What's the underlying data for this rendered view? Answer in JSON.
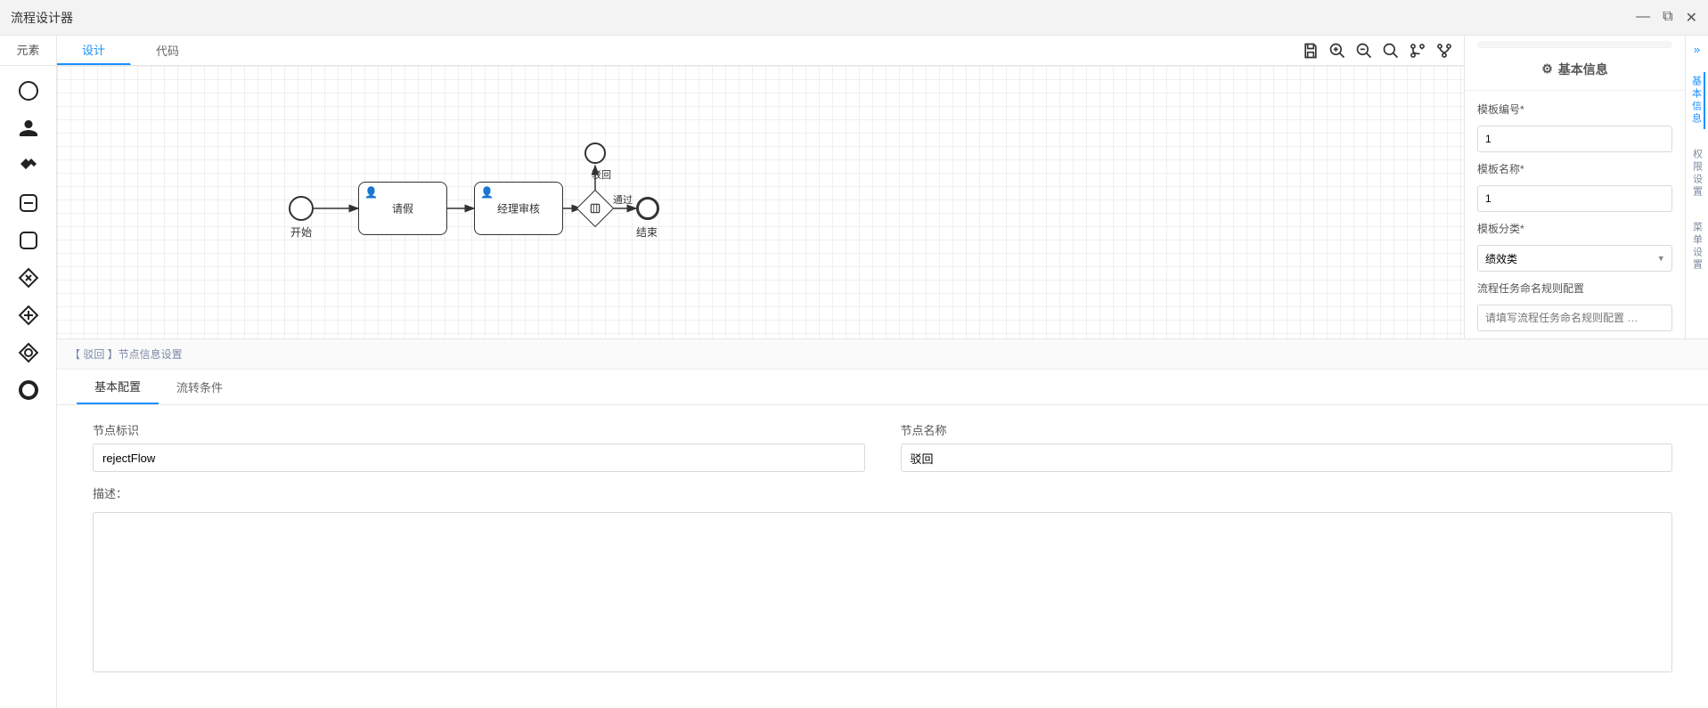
{
  "window": {
    "title": "流程设计器"
  },
  "left": {
    "header": "元素"
  },
  "centerTabs": {
    "design": "设计",
    "code": "代码"
  },
  "diagram": {
    "start": "开始",
    "task1": "请假",
    "task2": "经理审核",
    "gateway_icon": "⧠",
    "reject": "驳回",
    "pass": "通过",
    "end": "结束"
  },
  "bottom": {
    "header": "【 驳回 】节点信息设置",
    "tabs": {
      "basic": "基本配置",
      "flow": "流转条件"
    },
    "labels": {
      "nodeId": "节点标识",
      "nodeName": "节点名称",
      "desc": "描述："
    },
    "values": {
      "nodeId": "rejectFlow",
      "nodeName": "驳回",
      "desc": ""
    }
  },
  "right": {
    "header": "基本信息",
    "labels": {
      "templateNo": "模板编号*",
      "templateName": "模板名称*",
      "templateCategory": "模板分类*",
      "taskNaming": "流程任务命名规则配置"
    },
    "values": {
      "templateNo": "1",
      "templateName": "1",
      "templateCategory": "绩效类"
    },
    "placeholders": {
      "taskNaming": "请填写流程任务命名规则配置 …"
    }
  },
  "rail": {
    "tab1": "基本信息",
    "tab2": "权限设置",
    "tab3": "菜单设置"
  }
}
